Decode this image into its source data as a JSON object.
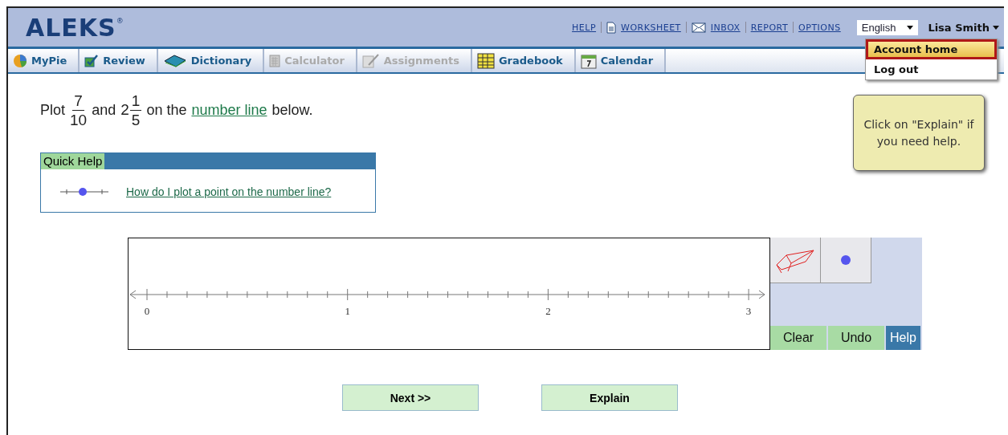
{
  "header": {
    "logo": "ALEKS",
    "logo_mark": "®",
    "links": [
      {
        "label": "HELP"
      },
      {
        "label": "WORKSHEET"
      },
      {
        "label": "INBOX"
      },
      {
        "label": "REPORT"
      },
      {
        "label": "OPTIONS"
      }
    ],
    "language": "English",
    "user": "Lisa Smith"
  },
  "user_menu": [
    {
      "label": "Account home",
      "selected": true
    },
    {
      "label": "Log out",
      "selected": false
    }
  ],
  "tabs": [
    {
      "label": "MyPie",
      "disabled": false
    },
    {
      "label": "Review",
      "disabled": false
    },
    {
      "label": "Dictionary",
      "disabled": false
    },
    {
      "label": "Calculator",
      "disabled": true
    },
    {
      "label": "Assignments",
      "disabled": true
    },
    {
      "label": "Gradebook",
      "disabled": false
    },
    {
      "label": "Calendar",
      "disabled": false
    }
  ],
  "question": {
    "prefix": "Plot",
    "fraction": {
      "numerator": "7",
      "denominator": "10"
    },
    "middle": "and",
    "mixed": {
      "whole": "2",
      "numerator": "1",
      "denominator": "5"
    },
    "before_link": "on the",
    "link": "number line",
    "suffix": "below."
  },
  "quick_help": {
    "title": "Quick Help",
    "link": "How do I plot a point on the number line?"
  },
  "tooltip": "Click on \"Explain\" if you need help.",
  "number_line": {
    "labels": [
      "0",
      "1",
      "2",
      "3"
    ]
  },
  "tool_buttons": [
    {
      "label": "Clear",
      "kind": "action"
    },
    {
      "label": "Undo",
      "kind": "action"
    },
    {
      "label": "Help",
      "kind": "help"
    }
  ],
  "buttons": [
    {
      "label": "Next >>"
    },
    {
      "label": "Explain"
    }
  ]
}
